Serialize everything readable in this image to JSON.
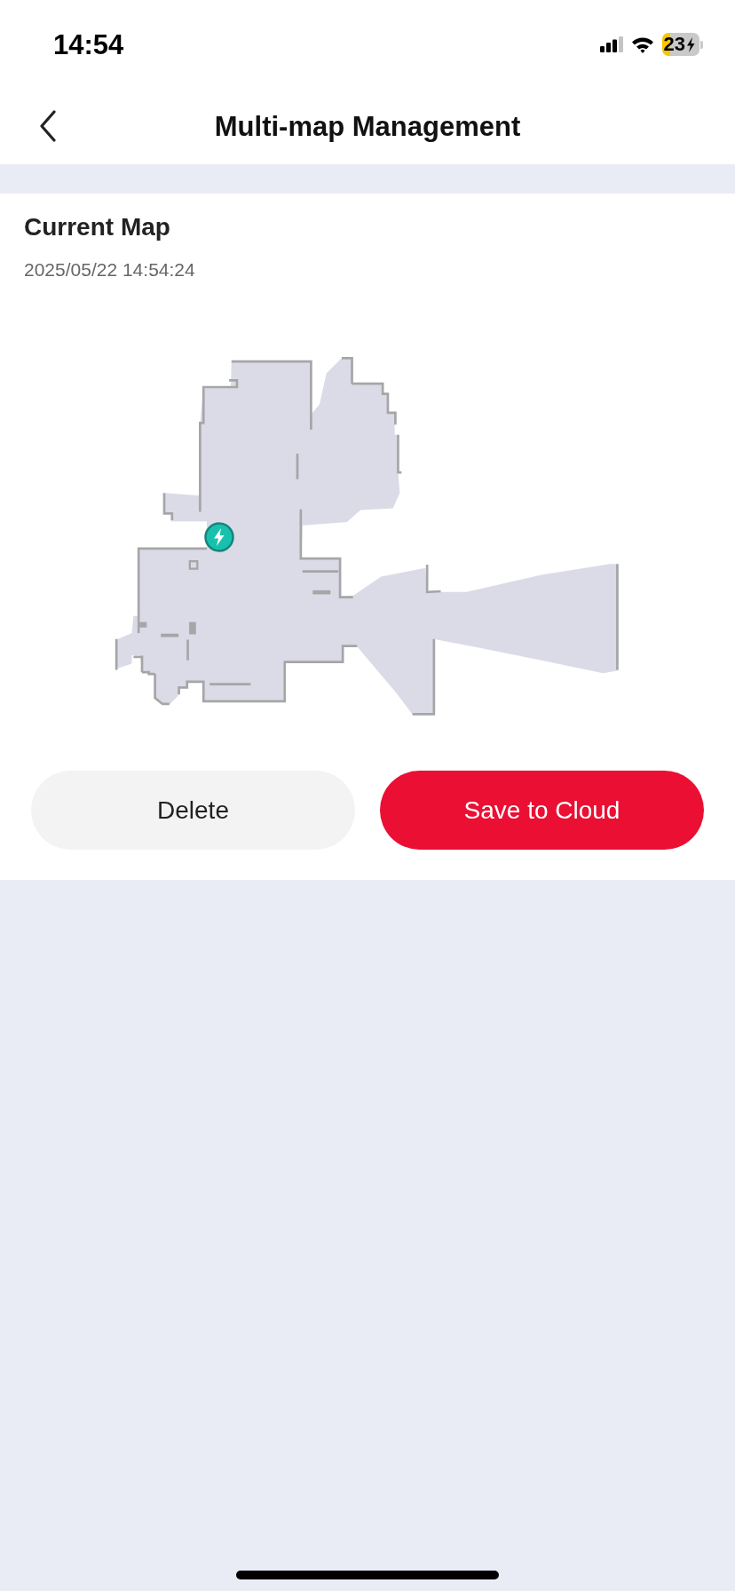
{
  "status_bar": {
    "time": "14:54",
    "battery": "23"
  },
  "nav": {
    "title": "Multi-map Management"
  },
  "map_card": {
    "title": "Current Map",
    "date": "2025/05/22 14:54:24"
  },
  "buttons": [
    {
      "label": "Delete",
      "kind": "secondary"
    },
    {
      "label": "Save to Cloud",
      "kind": "primary"
    }
  ]
}
